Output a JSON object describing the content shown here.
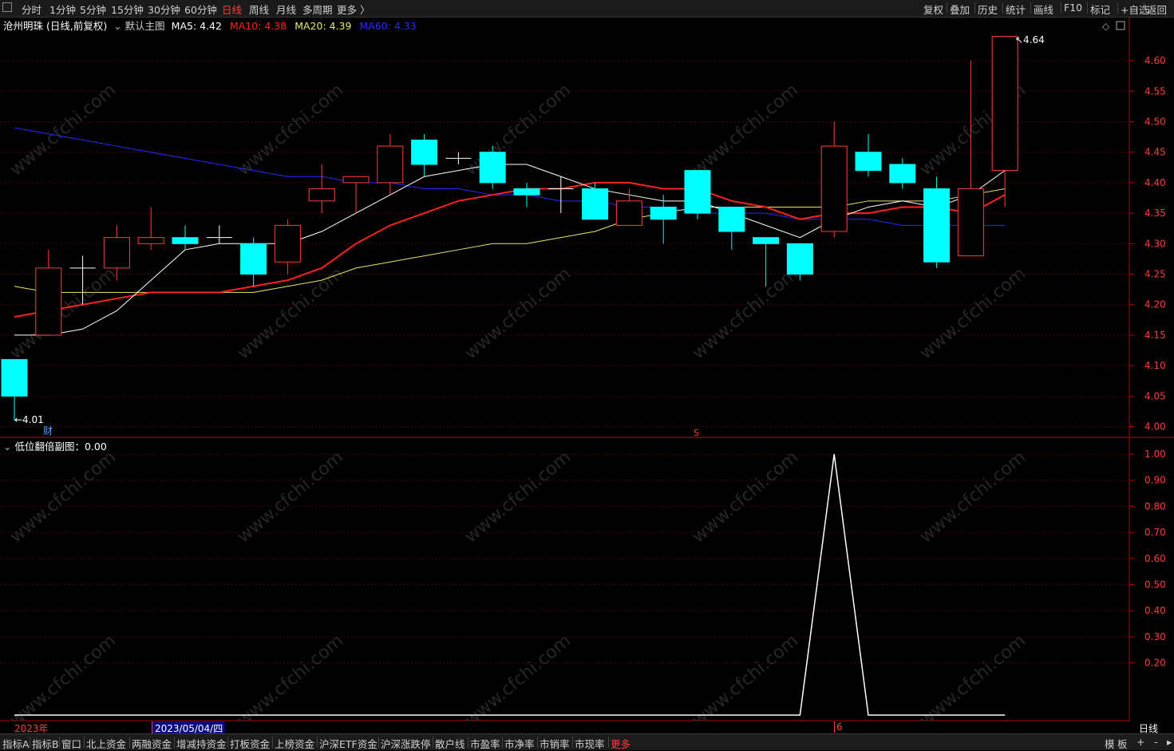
{
  "period_bar": {
    "periods": [
      "分时",
      "1分钟",
      "5分钟",
      "15分钟",
      "30分钟",
      "60分钟",
      "日线",
      "周线",
      "月线",
      "多周期",
      "更多 〉"
    ],
    "active": "日线",
    "tools": [
      "复权",
      "叠加",
      "历史",
      "统计",
      "画线",
      "F10",
      "标记",
      "+自选",
      "返回"
    ]
  },
  "main_chart": {
    "stock_title": "沧州明珠 (日线,前复权)",
    "template_label": "默认主图",
    "ma5_label": "MA5: 4.42",
    "ma10_label": "MA10: 4.38",
    "ma20_label": "MA20: 4.39",
    "ma60_label": "MA60: 4.33",
    "high_label": "4.64",
    "low_label": "4.01",
    "marker_cai": "财",
    "marker_s": "S",
    "y_ticks": [
      "4.60",
      "4.55",
      "4.50",
      "4.45",
      "4.40",
      "4.35",
      "4.30",
      "4.25",
      "4.20",
      "4.15",
      "4.10",
      "4.05",
      "4.00"
    ]
  },
  "sub_chart": {
    "title": "低位翻倍副图：0.00",
    "y_ticks": [
      "1.00",
      "0.90",
      "0.80",
      "0.70",
      "0.60",
      "0.50",
      "0.40",
      "0.30",
      "0.20"
    ]
  },
  "date_bar": {
    "year_label": "2023年",
    "cursor_date": "2023/05/04/四",
    "month_label": "6",
    "period_label": "日线"
  },
  "tab_bar": {
    "tabs": [
      "指标A",
      "指标B",
      "窗口",
      "北上资金",
      "两融资金",
      "增减持资金",
      "打板资金",
      "上榜资金",
      "沪深ETF资金",
      "沪深涨跌停",
      "散户线",
      "市盈率",
      "市净率",
      "市销率",
      "市现率",
      "更多"
    ],
    "right": [
      "模",
      "板",
      "+",
      "-",
      "▸"
    ]
  },
  "colors": {
    "up": "#ff3b3b",
    "down": "#00ffff",
    "ma5": "#ffffff",
    "ma10": "#ff2020",
    "ma20": "#e8e866",
    "ma60": "#2a2aff",
    "axis": "#c00000"
  },
  "chart_data": {
    "type": "candlestick",
    "ylim": [
      4.0,
      4.64
    ],
    "candles": [
      {
        "o": 4.11,
        "c": 4.05,
        "h": 4.11,
        "l": 4.01
      },
      {
        "o": 4.15,
        "c": 4.26,
        "h": 4.29,
        "l": 4.15
      },
      {
        "o": 4.26,
        "c": 4.26,
        "h": 4.28,
        "l": 4.2
      },
      {
        "o": 4.26,
        "c": 4.31,
        "h": 4.33,
        "l": 4.24
      },
      {
        "o": 4.3,
        "c": 4.31,
        "h": 4.36,
        "l": 4.29
      },
      {
        "o": 4.31,
        "c": 4.3,
        "h": 4.33,
        "l": 4.29
      },
      {
        "o": 4.31,
        "c": 4.31,
        "h": 4.33,
        "l": 4.3
      },
      {
        "o": 4.3,
        "c": 4.25,
        "h": 4.31,
        "l": 4.23
      },
      {
        "o": 4.27,
        "c": 4.33,
        "h": 4.34,
        "l": 4.25
      },
      {
        "o": 4.37,
        "c": 4.39,
        "h": 4.43,
        "l": 4.35
      },
      {
        "o": 4.4,
        "c": 4.41,
        "h": 4.41,
        "l": 4.35
      },
      {
        "o": 4.4,
        "c": 4.46,
        "h": 4.48,
        "l": 4.38
      },
      {
        "o": 4.47,
        "c": 4.43,
        "h": 4.48,
        "l": 4.41
      },
      {
        "o": 4.44,
        "c": 4.44,
        "h": 4.45,
        "l": 4.43
      },
      {
        "o": 4.45,
        "c": 4.4,
        "h": 4.46,
        "l": 4.39
      },
      {
        "o": 4.39,
        "c": 4.38,
        "h": 4.4,
        "l": 4.36
      },
      {
        "o": 4.39,
        "c": 4.39,
        "h": 4.41,
        "l": 4.35
      },
      {
        "o": 4.39,
        "c": 4.34,
        "h": 4.4,
        "l": 4.34
      },
      {
        "o": 4.33,
        "c": 4.37,
        "h": 4.39,
        "l": 4.33
      },
      {
        "o": 4.36,
        "c": 4.34,
        "h": 4.38,
        "l": 4.3
      },
      {
        "o": 4.42,
        "c": 4.35,
        "h": 4.42,
        "l": 4.34
      },
      {
        "o": 4.36,
        "c": 4.32,
        "h": 4.36,
        "l": 4.29
      },
      {
        "o": 4.31,
        "c": 4.3,
        "h": 4.31,
        "l": 4.23
      },
      {
        "o": 4.3,
        "c": 4.25,
        "h": 4.3,
        "l": 4.24
      },
      {
        "o": 4.32,
        "c": 4.46,
        "h": 4.5,
        "l": 4.31
      },
      {
        "o": 4.45,
        "c": 4.42,
        "h": 4.48,
        "l": 4.41
      },
      {
        "o": 4.43,
        "c": 4.4,
        "h": 4.44,
        "l": 4.39
      },
      {
        "o": 4.39,
        "c": 4.27,
        "h": 4.41,
        "l": 4.26
      },
      {
        "o": 4.28,
        "c": 4.39,
        "h": 4.6,
        "l": 4.28
      },
      {
        "o": 4.42,
        "c": 4.64,
        "h": 4.64,
        "l": 4.36
      }
    ],
    "ma5": [
      4.15,
      4.15,
      4.16,
      4.19,
      4.24,
      4.29,
      4.3,
      4.3,
      4.3,
      4.32,
      4.35,
      4.38,
      4.41,
      4.42,
      4.43,
      4.43,
      4.41,
      4.39,
      4.38,
      4.37,
      4.37,
      4.35,
      4.33,
      4.31,
      4.34,
      4.36,
      4.37,
      4.36,
      4.38,
      4.42
    ],
    "ma10": [
      4.18,
      4.19,
      4.2,
      4.21,
      4.22,
      4.22,
      4.22,
      4.23,
      4.24,
      4.26,
      4.3,
      4.33,
      4.35,
      4.37,
      4.38,
      4.39,
      4.39,
      4.4,
      4.4,
      4.39,
      4.39,
      4.37,
      4.36,
      4.34,
      4.35,
      4.35,
      4.36,
      4.36,
      4.35,
      4.38
    ],
    "ma20": [
      4.23,
      4.22,
      4.22,
      4.22,
      4.22,
      4.22,
      4.22,
      4.22,
      4.23,
      4.24,
      4.26,
      4.27,
      4.28,
      4.29,
      4.3,
      4.3,
      4.31,
      4.32,
      4.34,
      4.35,
      4.36,
      4.36,
      4.36,
      4.36,
      4.36,
      4.37,
      4.37,
      4.37,
      4.38,
      4.39
    ],
    "ma60": [
      4.49,
      4.48,
      4.47,
      4.46,
      4.45,
      4.44,
      4.43,
      4.42,
      4.41,
      4.41,
      4.4,
      4.4,
      4.39,
      4.39,
      4.38,
      4.38,
      4.37,
      4.37,
      4.36,
      4.36,
      4.35,
      4.35,
      4.35,
      4.34,
      4.34,
      4.34,
      4.33,
      4.33,
      4.33,
      4.33
    ],
    "sub_series": [
      0,
      0,
      0,
      0,
      0,
      0,
      0,
      0,
      0,
      0,
      0,
      0,
      0,
      0,
      0,
      0,
      0,
      0,
      0,
      0,
      0,
      0,
      0,
      0,
      1,
      0,
      0,
      0,
      0,
      0
    ]
  }
}
